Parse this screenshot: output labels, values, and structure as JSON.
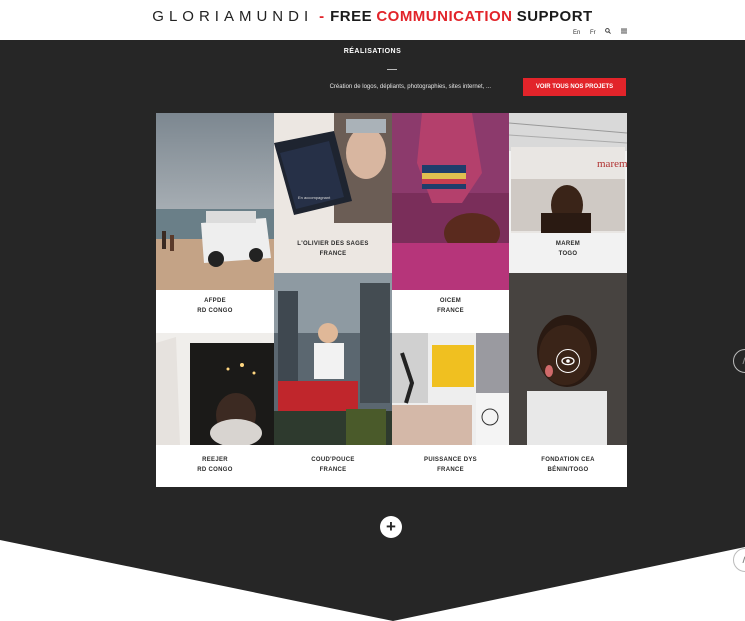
{
  "header": {
    "brand": "GLORIAMUNDI",
    "separator": "-",
    "tag_free": "FREE",
    "tag_comm": "COMMUNICATION",
    "tag_support": "SUPPORT",
    "nav": {
      "lang_en": "En",
      "lang_fr": "Fr",
      "search_icon": "search-icon",
      "menu_icon": "menu-icon"
    }
  },
  "section": {
    "title": "RÉALISATIONS",
    "subtitle": "Création de logos, dépliants, photographies, sites internet, ...",
    "cta": "VOIR TOUS NOS PROJETS"
  },
  "projects": [
    {
      "name": "AFPDE",
      "place": "RD CONGO"
    },
    {
      "name": "L'OLIVIER DES SAGES",
      "place": "FRANCE"
    },
    {
      "name": "OICEM",
      "place": "FRANCE"
    },
    {
      "name": "MAREM",
      "place": "TOGO"
    },
    {
      "name": "REEJER",
      "place": "RD CONGO"
    },
    {
      "name": "COUD'POUCE",
      "place": "FRANCE"
    },
    {
      "name": "PUISSANCE DYS",
      "place": "FRANCE"
    },
    {
      "name": "FONDATION CEA",
      "place": "BÉNIN/TOGO"
    }
  ],
  "marem_sign": "marem",
  "more_icon": "+",
  "colors": {
    "accent": "#e2242a",
    "dark": "#262626"
  }
}
